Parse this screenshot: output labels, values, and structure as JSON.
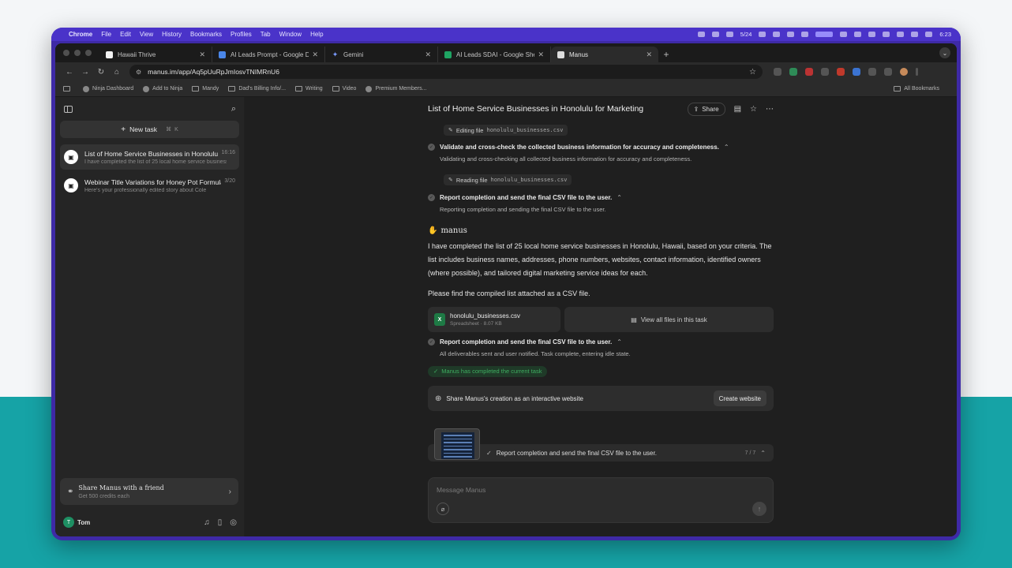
{
  "menubar": {
    "apple": "",
    "items": [
      "Chrome",
      "File",
      "Edit",
      "View",
      "History",
      "Bookmarks",
      "Profiles",
      "Tab",
      "Window",
      "Help"
    ],
    "date": "5/24",
    "clock": "6:23"
  },
  "tabs": [
    {
      "label": "Hawaii Thrive",
      "color": "#f2f2f2"
    },
    {
      "label": "AI Leads Prompt - Google Do",
      "color": "#4a86e8"
    },
    {
      "label": "Gemini",
      "color": "#7b9cff"
    },
    {
      "label": "AI Leads SDAI - Google Shee",
      "color": "#1fa463"
    },
    {
      "label": "Manus",
      "color": "#dddddd"
    }
  ],
  "url": "manus.im/app/Aq5pUuRpJmIosvTNIMRnU6",
  "bookmarks": [
    "Ninja Dashboard",
    "Add to Ninja",
    "Mandy",
    "Dad's Billing Info/...",
    "Writing",
    "Video",
    "Premium Members..."
  ],
  "all_bookmarks": "All Bookmarks",
  "sidebar": {
    "new_task": "New task",
    "shortcut_cmd": "⌘",
    "shortcut_key": "K",
    "tasks": [
      {
        "title": "List of Home Service Businesses in Honolulu for Marketing",
        "date": "16:16",
        "preview": "I have completed the list of 25 local home service businesses in Honolulu"
      },
      {
        "title": "Webinar Title Variations for Honey Pot Formula",
        "date": "3/20",
        "preview": "Here's your professionally edited story about Cole"
      }
    ],
    "share_title": "Share Manus with a friend",
    "share_sub": "Get 500 credits each",
    "user_name": "Tom",
    "user_initial": "T"
  },
  "main": {
    "title": "List of Home Service Businesses in Honolulu for Marketing",
    "share_label": "Share",
    "editing_label": "Editing file",
    "editing_file": "honolulu_businesses.csv",
    "step1_title": "Validate and cross-check the collected business information for accuracy and completeness.",
    "step1_desc": "Validating and cross-checking all collected business information for accuracy and completeness.",
    "reading_label": "Reading file",
    "reading_file": "honolulu_businesses.csv",
    "step2_title": "Report completion and send the final CSV file to the user.",
    "step2_desc": "Reporting completion and sending the final CSV file to the user.",
    "brand": "manus",
    "para1": "I have completed the list of 25 local home service businesses in Honolulu, Hawaii, based on your criteria. The list includes business names, addresses, phone numbers, websites, contact information, identified owners (where possible), and tailored digital marketing service ideas for each.",
    "para2": "Please find the compiled list attached as a CSV file.",
    "file_name": "honolulu_businesses.csv",
    "file_meta": "Spreadsheet · 8.07 KB",
    "view_all": "View all files in this task",
    "step3_title": "Report completion and send the final CSV file to the user.",
    "step3_desc": "All deliverables sent and user notified. Task complete, entering idle state.",
    "completed": "Manus has completed the current task",
    "share_web": "Share Manus's creation as an interactive website",
    "create_website": "Create website",
    "progress_text": "Report completion and send the final CSV file to the user.",
    "progress_count": "7 / 7",
    "composer_placeholder": "Message Manus"
  }
}
